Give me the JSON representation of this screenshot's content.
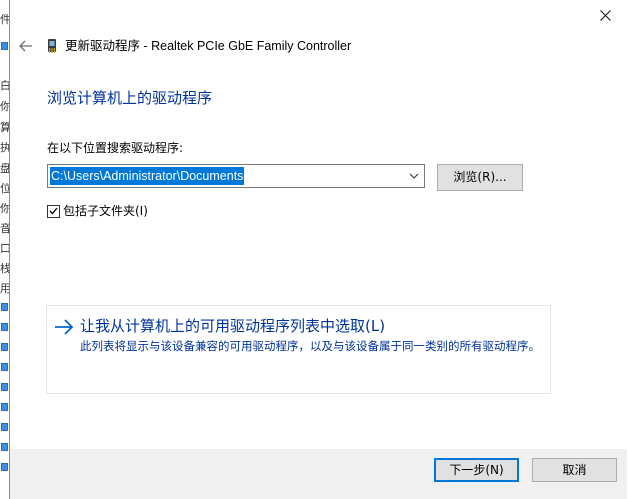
{
  "background_window": {
    "glyphs": [
      "件",
      "",
      "白",
      "你",
      "算",
      "执",
      "盘",
      "位",
      "你",
      "音",
      "口",
      "栈",
      "用",
      "他"
    ]
  },
  "header": {
    "title": "更新驱动程序 - Realtek PCIe GbE Family Controller",
    "back_icon": "back-arrow-icon",
    "device_icon": "network-adapter-icon",
    "close_icon": "close-icon"
  },
  "main": {
    "heading": "浏览计算机上的驱动程序",
    "search_label": "在以下位置搜索驱动程序:",
    "path_value": "C:\\Users\\Administrator\\Documents",
    "browse_label": "浏览(R)...",
    "include_subfolders_label": "包括子文件夹(I)",
    "include_subfolders_checked": true
  },
  "pick_option": {
    "title": "让我从计算机上的可用驱动程序列表中选取(L)",
    "description": "此列表将显示与该设备兼容的可用驱动程序，以及与该设备属于同一类别的所有驱动程序。"
  },
  "footer": {
    "next_label": "下一步(N)",
    "cancel_label": "取消"
  },
  "colors": {
    "accent": "#0078d7",
    "link": "#003399",
    "button_face": "#e1e1e1",
    "footer_bg": "#f0f0f0"
  }
}
